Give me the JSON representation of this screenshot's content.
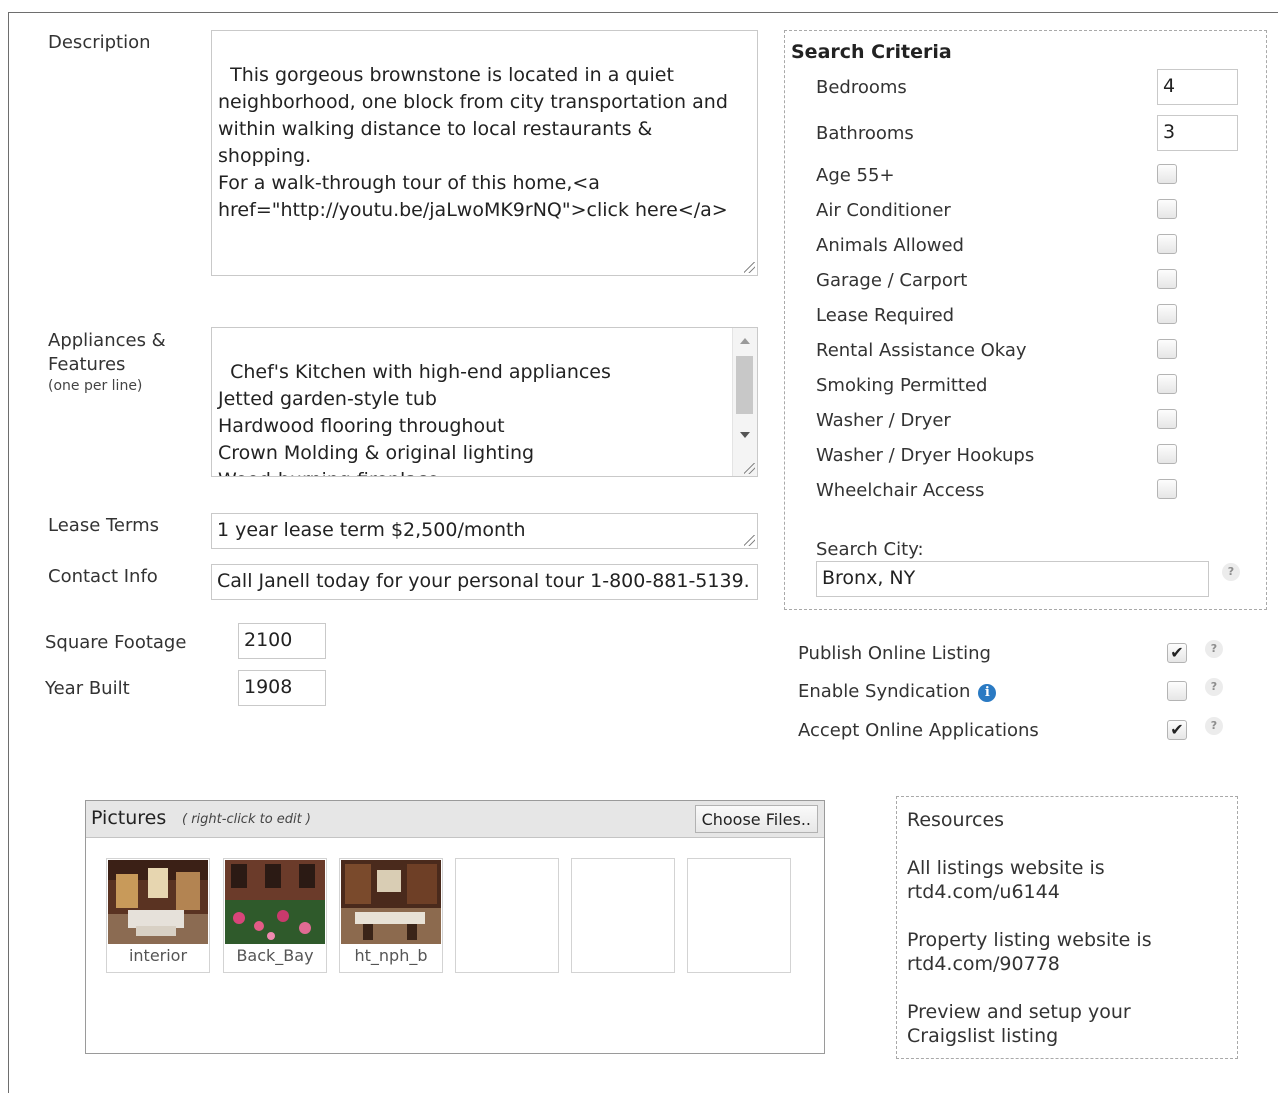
{
  "form": {
    "description_label": "Description",
    "description_value": "This gorgeous brownstone is located in a quiet\nneighborhood, one block from city transportation and\nwithin walking distance to local restaurants & shopping.\nFor a walk-through tour of this home,<a\nhref=\"http://youtu.be/jaLwoMK9rNQ\">click here</a>",
    "features_label": "Appliances &\nFeatures",
    "features_hint": "(one per line)",
    "features_value": "Chef's Kitchen with high-end appliances\nJetted garden-style tub\nHardwood flooring throughout\nCrown Molding & original lighting\nWood-burning fireplace",
    "lease_label": "Lease Terms",
    "lease_value": "1 year lease term $2,500/month",
    "contact_label": "Contact Info",
    "contact_value": "Call Janell today for your personal tour 1-800-881-5139.",
    "sqft_label": "Square Footage",
    "sqft_value": "2100",
    "year_label": "Year Built",
    "year_value": "1908"
  },
  "search": {
    "title": "Search Criteria",
    "bedrooms_label": "Bedrooms",
    "bedrooms_value": "4",
    "bathrooms_label": "Bathrooms",
    "bathrooms_value": "3",
    "checks": [
      {
        "label": "Age 55+",
        "checked": false
      },
      {
        "label": "Air Conditioner",
        "checked": false
      },
      {
        "label": "Animals Allowed",
        "checked": false
      },
      {
        "label": "Garage / Carport",
        "checked": false
      },
      {
        "label": "Lease Required",
        "checked": false
      },
      {
        "label": "Rental Assistance Okay",
        "checked": false
      },
      {
        "label": "Smoking Permitted",
        "checked": false
      },
      {
        "label": "Washer / Dryer",
        "checked": false
      },
      {
        "label": "Washer / Dryer Hookups",
        "checked": false
      },
      {
        "label": "Wheelchair Access",
        "checked": false
      }
    ],
    "city_label": "Search City:",
    "city_value": "Bronx, NY"
  },
  "publish": {
    "items": [
      {
        "label": "Publish Online Listing",
        "checked": true
      },
      {
        "label": "Enable Syndication",
        "checked": false
      },
      {
        "label": "Accept Online Applications",
        "checked": true
      }
    ],
    "help_glyph": "?",
    "info_glyph": "i",
    "check_glyph": "✔"
  },
  "pictures": {
    "title": "Pictures",
    "hint": "( right-click to edit )",
    "choose_label": "Choose Files..",
    "items": [
      {
        "caption": "interior"
      },
      {
        "caption": "Back_Bay"
      },
      {
        "caption": "ht_nph_b"
      }
    ]
  },
  "resources": {
    "title": "Resources",
    "all_text": "All listings website is",
    "all_link": "rtd4.com/u6144",
    "prop_text": "Property listing website is",
    "prop_link": "rtd4.com/90778",
    "cl_text": "Preview and setup your",
    "cl_link": "Craigslist listing"
  },
  "colors": {
    "link": "#2a5d9f",
    "info_icon": "#2a7ac3",
    "border": "#c9c9c9"
  }
}
